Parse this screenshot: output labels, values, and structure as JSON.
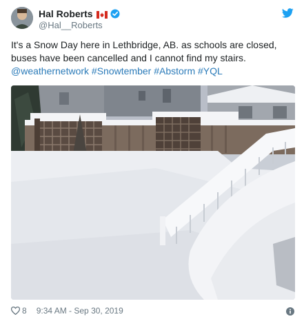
{
  "user": {
    "display_name": "Hal Roberts",
    "handle": "@Hal__Roberts",
    "verified": true,
    "flag": "canada-flag-icon"
  },
  "tweet": {
    "text_intro": "It's a Snow Day here in Lethbridge, AB. as schools are closed, buses have been cancelled and I cannot find my stairs.",
    "hashtags": "@weathernetwork #Snowtember #Abstorm #YQL"
  },
  "footer": {
    "likes": "8",
    "timestamp": "9:34 AM - Sep 30, 2019"
  },
  "colors": {
    "twitter_blue": "#1da1f2",
    "link_blue": "#2b7bb9",
    "secondary_text": "#697882"
  },
  "icons": [
    "twitter-logo-icon",
    "verified-icon",
    "canada-flag-icon",
    "heart-icon",
    "info-icon"
  ]
}
